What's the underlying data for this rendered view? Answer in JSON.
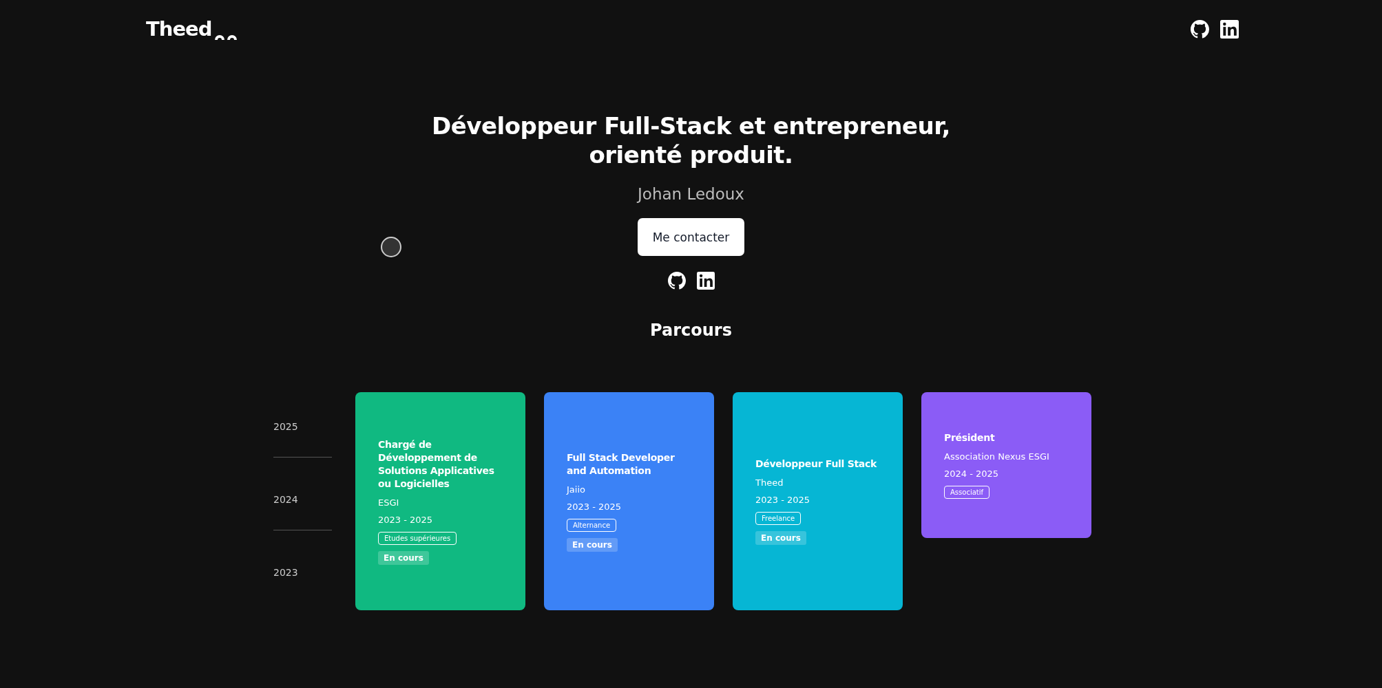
{
  "header": {
    "logo": "Theed"
  },
  "hero": {
    "headline": [
      "Développeur Full-Stack et entrepreneur,",
      "orienté produit."
    ],
    "name": "Johan Ledoux",
    "button": "Me contacter"
  },
  "parcours": {
    "title": "Parcours",
    "years": [
      "2025",
      "2024",
      "2023"
    ],
    "cards": [
      {
        "title": "Chargé de Développement de Solutions Applicatives ou Logicielles",
        "org": "ESGI",
        "period": "2023 - 2025",
        "tag": "Etudes supérieures",
        "status": "En cours",
        "color": "#10b981",
        "tall": true
      },
      {
        "title": "Full Stack Developer and Automation",
        "org": "Jaiio",
        "period": "2023 - 2025",
        "tag": "Alternance",
        "status": "En cours",
        "color": "#3b82f6",
        "tall": true
      },
      {
        "title": "Développeur Full Stack",
        "org": "Theed",
        "period": "2023 - 2025",
        "tag": "Freelance",
        "status": "En cours",
        "color": "#06b6d4",
        "tall": true
      },
      {
        "title": "Président",
        "org": "Association Nexus ESGI",
        "period": "2024 - 2025",
        "tag": "Associatif",
        "color": "#8b5cf6",
        "tall": false
      }
    ]
  }
}
